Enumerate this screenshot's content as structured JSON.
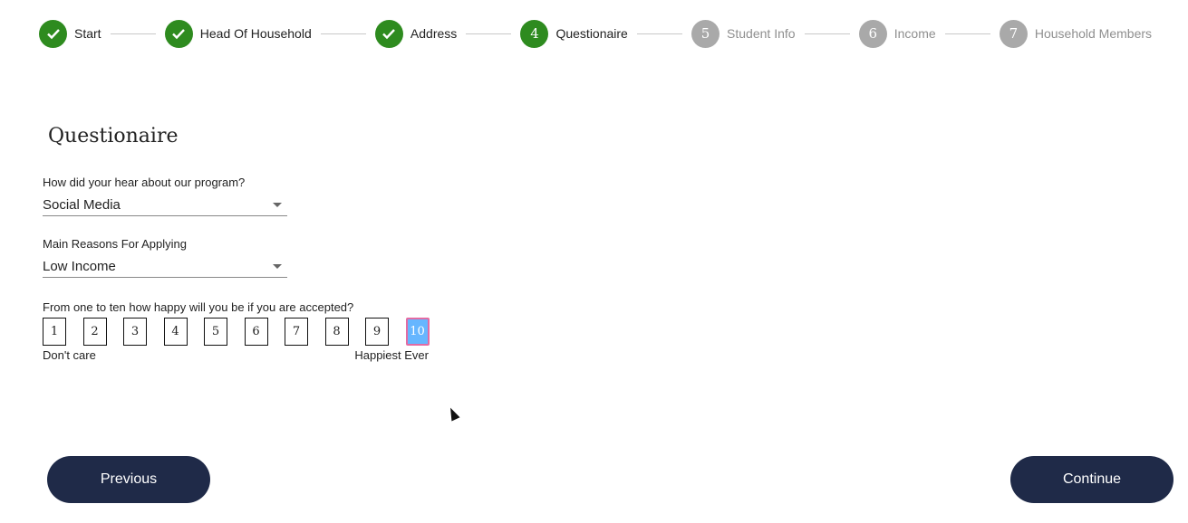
{
  "stepper": {
    "steps": [
      {
        "label": "Start",
        "number": "1",
        "state": "done"
      },
      {
        "label": "Head Of Household",
        "number": "2",
        "state": "done"
      },
      {
        "label": "Address",
        "number": "3",
        "state": "done"
      },
      {
        "label": "Questionaire",
        "number": "4",
        "state": "active"
      },
      {
        "label": "Student Info",
        "number": "5",
        "state": "todo"
      },
      {
        "label": "Income",
        "number": "6",
        "state": "todo"
      },
      {
        "label": "Household Members",
        "number": "7",
        "state": "todo"
      }
    ]
  },
  "page_title": "Questionaire",
  "fields": {
    "hear": {
      "label": "How did your hear about our program?",
      "value": "Social Media"
    },
    "reason": {
      "label": "Main Reasons For Applying",
      "value": "Low Income"
    }
  },
  "rating": {
    "label": "From one to ten how happy will you be if you are accepted?",
    "options": [
      "1",
      "2",
      "3",
      "4",
      "5",
      "6",
      "7",
      "8",
      "9",
      "10"
    ],
    "selected": "10",
    "min_label": "Don't care",
    "max_label": "Happiest Ever"
  },
  "buttons": {
    "previous": "Previous",
    "continue": "Continue"
  },
  "colors": {
    "done": "#2e8b1f",
    "todo": "#a9a9a9",
    "button": "#1f2a48",
    "selected_fill": "#66b6ff",
    "selected_border": "#e36ba3"
  }
}
